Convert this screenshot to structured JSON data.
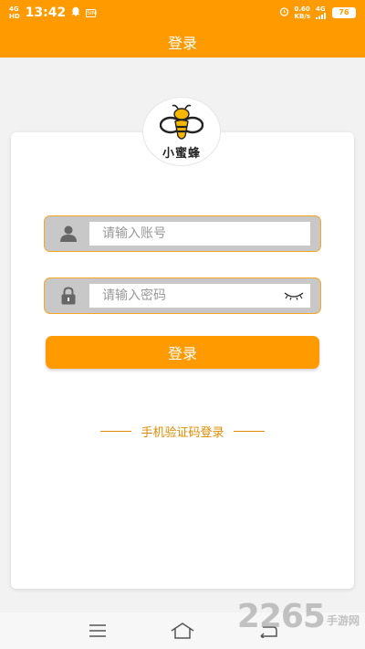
{
  "status_bar": {
    "network_left_top": "4G",
    "network_left_bottom": "HD",
    "time": "13:42",
    "sim_label": "SIM",
    "speed_top": "0.60",
    "speed_bottom": "KB/s",
    "network_right": "4G",
    "battery": "76"
  },
  "header": {
    "title": "登录"
  },
  "logo": {
    "text": "小蜜蜂"
  },
  "form": {
    "account_placeholder": "请输入账号",
    "password_placeholder": "请输入密码",
    "login_label": "登录",
    "sms_login_label": "手机验证码登录"
  },
  "watermark": {
    "number": "2265",
    "text": "手游网"
  },
  "colors": {
    "accent": "#ff9a00",
    "field_border": "#f5a623",
    "field_bg": "#c8c8c8",
    "sms_text": "#e08a00"
  }
}
